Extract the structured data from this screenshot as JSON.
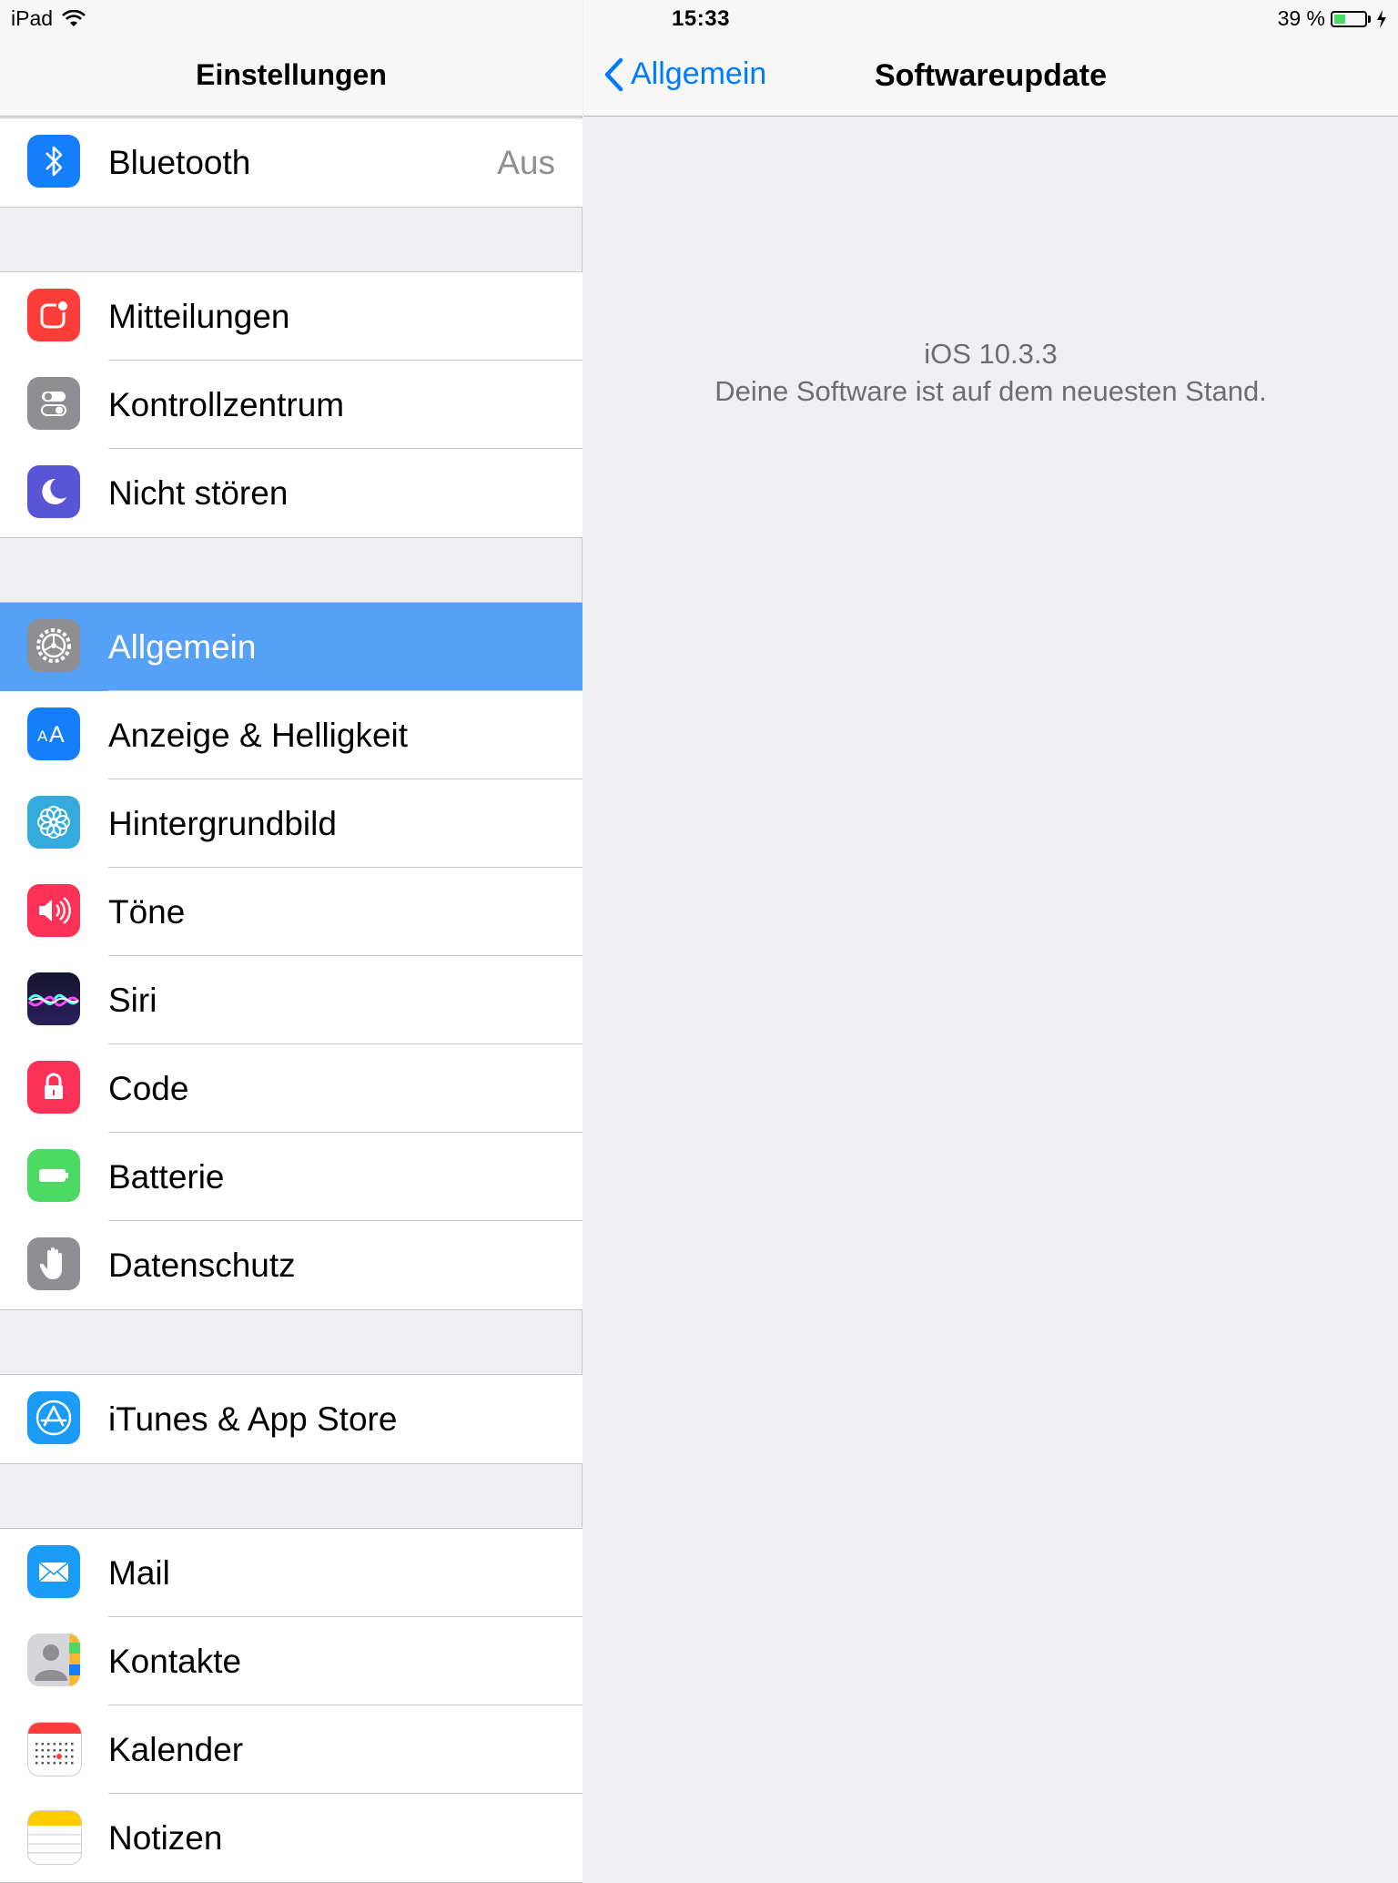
{
  "statusbar": {
    "device": "iPad",
    "time": "15:33",
    "battery_text": "39 %",
    "battery_level": 0.39
  },
  "master": {
    "title": "Einstellungen",
    "groups": [
      [
        {
          "label": "Bluetooth",
          "detail": "Aus",
          "icon": "bluetooth-icon"
        }
      ],
      [
        {
          "label": "Mitteilungen",
          "icon": "notifications-icon"
        },
        {
          "label": "Kontrollzentrum",
          "icon": "control-center-icon"
        },
        {
          "label": "Nicht stören",
          "icon": "moon-icon"
        }
      ],
      [
        {
          "label": "Allgemein",
          "icon": "gear-icon",
          "selected": true
        },
        {
          "label": "Anzeige & Helligkeit",
          "icon": "display-brightness-icon"
        },
        {
          "label": "Hintergrundbild",
          "icon": "wallpaper-flower-icon"
        },
        {
          "label": "Töne",
          "icon": "speaker-icon"
        },
        {
          "label": "Siri",
          "icon": "siri-icon"
        },
        {
          "label": "Code",
          "icon": "lock-icon"
        },
        {
          "label": "Batterie",
          "icon": "battery-icon"
        },
        {
          "label": "Datenschutz",
          "icon": "hand-icon"
        }
      ],
      [
        {
          "label": "iTunes & App Store",
          "icon": "app-store-icon"
        }
      ],
      [
        {
          "label": "Mail",
          "icon": "mail-icon"
        },
        {
          "label": "Kontakte",
          "icon": "contacts-icon"
        },
        {
          "label": "Kalender",
          "icon": "calendar-icon"
        },
        {
          "label": "Notizen",
          "icon": "notes-icon"
        }
      ]
    ]
  },
  "detail": {
    "back_label": "Allgemein",
    "title": "Softwareupdate",
    "version": "iOS 10.3.3",
    "status": "Deine Software ist auf dem neuesten Stand."
  },
  "colors": {
    "accent": "#007aff",
    "selected_row": "#56a1f8",
    "background": "#efeff4"
  }
}
